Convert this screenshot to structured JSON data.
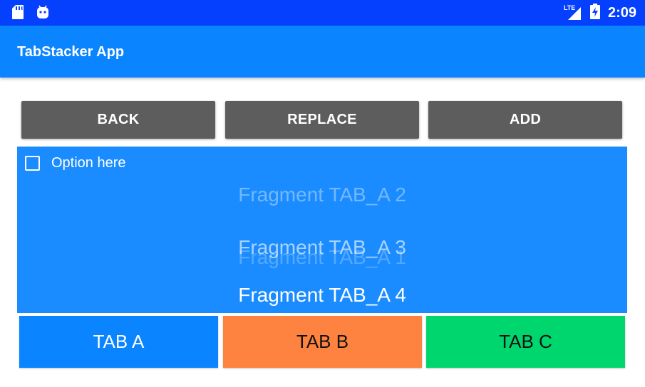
{
  "status_bar": {
    "time": "2:09",
    "network": "LTE",
    "icons": [
      "sd-card-icon",
      "android-icon",
      "signal-icon",
      "battery-charging-icon"
    ]
  },
  "app_bar": {
    "title": "TabStacker App"
  },
  "actions": {
    "back": "BACK",
    "replace": "REPLACE",
    "add": "ADD"
  },
  "fragment": {
    "checkbox_label": "Option here",
    "checkbox_checked": false,
    "stack": [
      "Fragment TAB_A 1",
      "Fragment TAB_A 2",
      "Fragment TAB_A 3",
      "Fragment TAB_A 4"
    ]
  },
  "tabs": [
    {
      "label": "TAB A",
      "color": "#0a84ff"
    },
    {
      "label": "TAB B",
      "color": "#ff8340"
    },
    {
      "label": "TAB C",
      "color": "#00d66e"
    }
  ],
  "colors": {
    "status_bar": "#0540ff",
    "app_bar": "#0a84ff",
    "fragment_bg": "#1b8cff",
    "button": "#5d5d5d"
  }
}
